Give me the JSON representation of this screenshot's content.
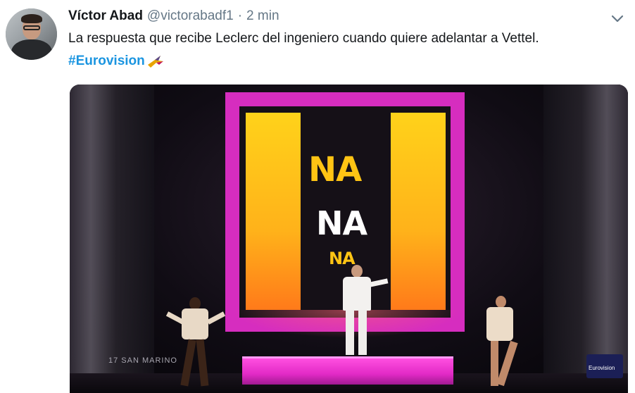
{
  "tweet": {
    "author_name": "Víctor Abad",
    "handle": "@victorabadf1",
    "separator": "·",
    "time": "2 min",
    "text": "La respuesta que recibe Leclerc del ingeniero cuando quiere adelantar a Vettel.",
    "hashtag": "#Eurovision",
    "hashflag_icon": "eurovision-hashflag-icon",
    "chevron_icon": "chevron-down-icon"
  },
  "media": {
    "screen_text": [
      "NA",
      "NA",
      "NA"
    ],
    "caption": "17  SAN MARINO",
    "logo_text": "Eurovision"
  },
  "colors": {
    "link": "#1b95e0",
    "muted": "#657786",
    "screen_frame": "#d62dbf"
  }
}
